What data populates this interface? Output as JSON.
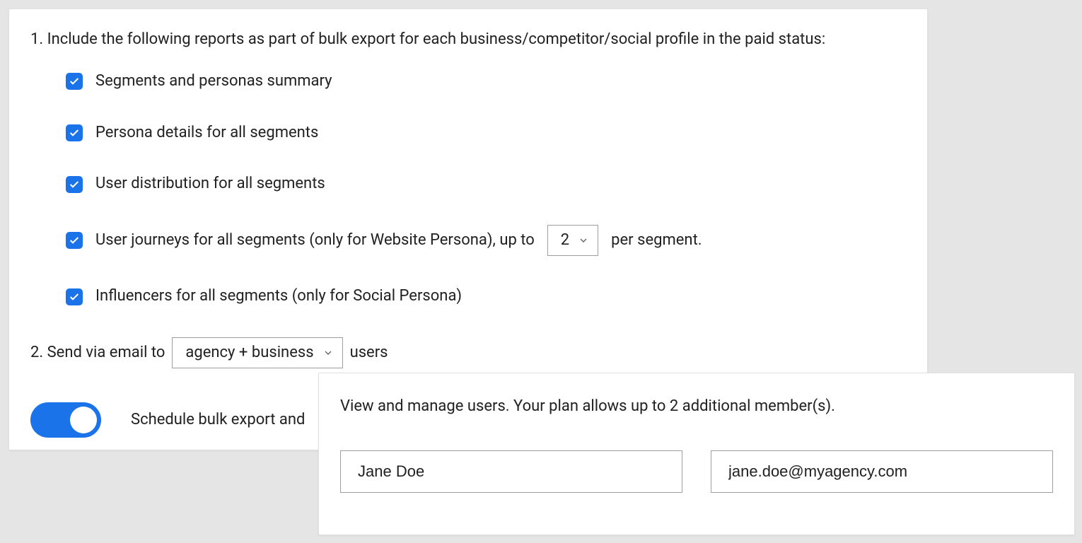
{
  "section1": {
    "heading": "1. Include the following reports as part of bulk export for each business/competitor/social profile in the paid status:",
    "items": [
      {
        "label": "Segments and personas summary",
        "checked": true
      },
      {
        "label": "Persona details for all segments",
        "checked": true
      },
      {
        "label": "User distribution for all segments",
        "checked": true
      },
      {
        "label_pre": "User journeys for all segments (only for Website Persona), up to",
        "select_value": "2",
        "label_post": "per segment.",
        "checked": true
      },
      {
        "label": "Influencers for all segments (only for Social Persona)",
        "checked": true
      }
    ]
  },
  "section2": {
    "label_pre": "2. Send via email to",
    "select_value": "agency + business",
    "label_post": "users"
  },
  "schedule": {
    "toggle_on": true,
    "label": "Schedule bulk export and"
  },
  "popup": {
    "text": "View and manage users. Your plan allows up to 2 additional member(s).",
    "name_value": "Jane Doe",
    "email_value": "jane.doe@myagency.com"
  }
}
